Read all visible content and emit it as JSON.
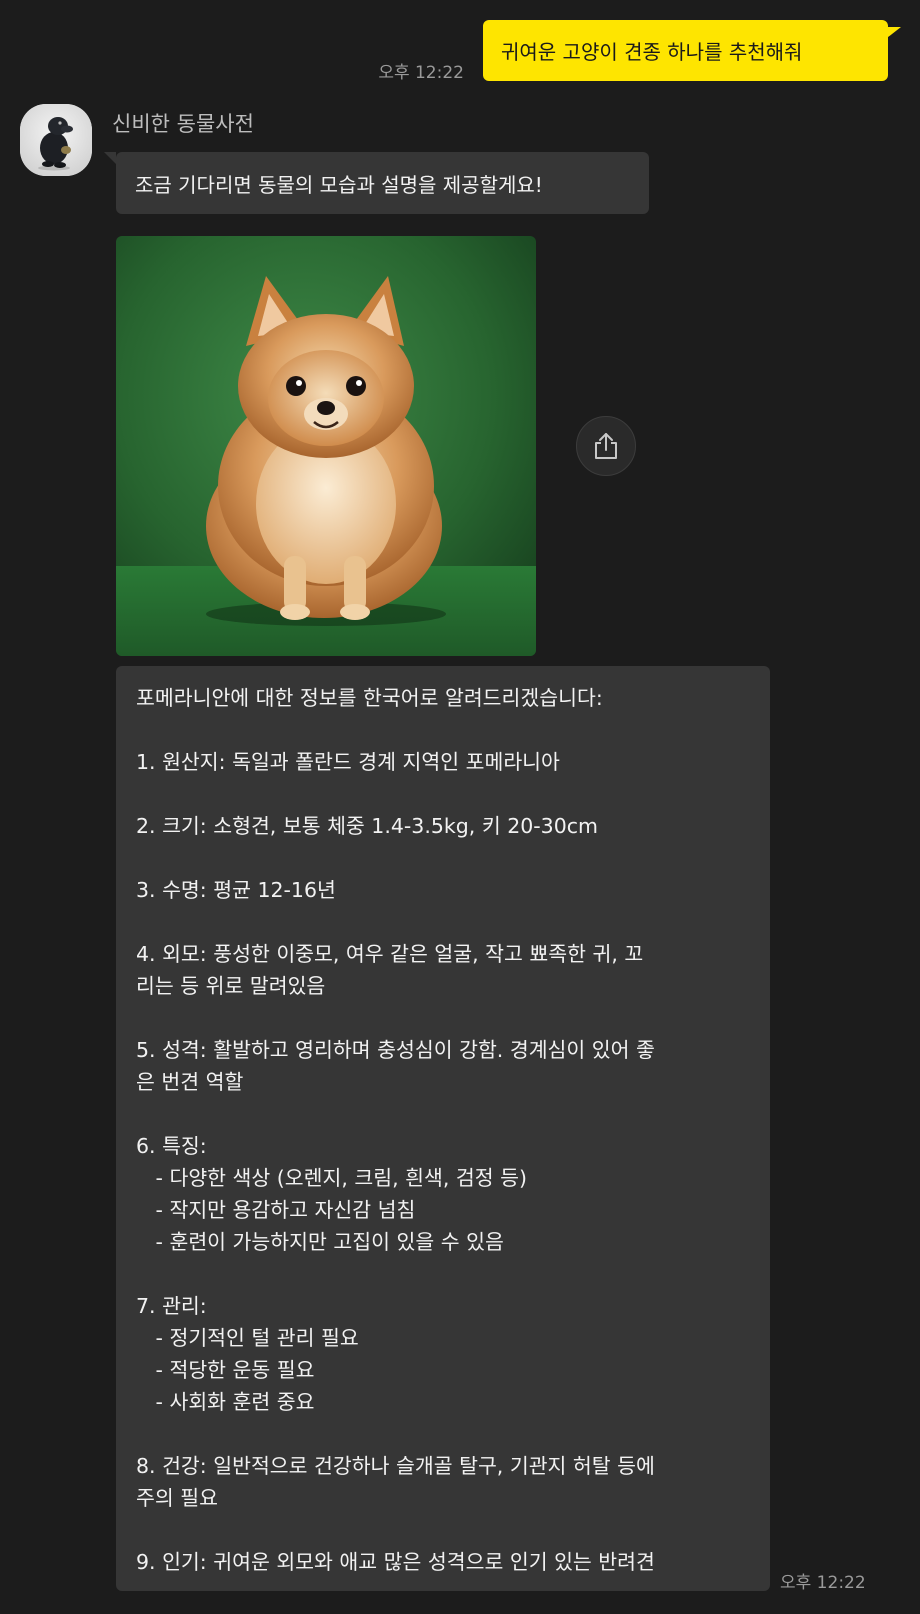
{
  "outgoing": {
    "text": "귀여운 고양이 견종 하나를 추천해줘",
    "time": "오후 12:22",
    "bubble_color": "#fee500"
  },
  "sender": {
    "name": "신비한 동물사전",
    "avatar_icon": "niffler-creature-avatar"
  },
  "incoming": {
    "greeting": "조금 기다리면 동물의 모습과 설명을 제공할게요!",
    "image_icon": "pomeranian-photo",
    "share_icon": "share-icon",
    "time": "오후 12:22",
    "bubble_color": "#363636",
    "info": {
      "intro": "포메라니안에 대한 정보를 한국어로 알려드리겠습니다:",
      "item1": "1. 원산지: 독일과 폴란드 경계 지역인 포메라니아",
      "item2": "2. 크기: 소형견, 보통 체중 1.4-3.5kg, 키 20-30cm",
      "item3": "3. 수명: 평균 12-16년",
      "item4_l1": "4. 외모: 풍성한 이중모, 여우 같은 얼굴, 작고 뾰족한 귀, 꼬",
      "item4_l2": "리는 등 위로 말려있음",
      "item5_l1": "5. 성격: 활발하고 영리하며 충성심이 강함. 경계심이 있어 좋",
      "item5_l2": "은 번견 역할",
      "item6_title": "6. 특징:",
      "item6_sub1": "   - 다양한 색상 (오렌지, 크림, 흰색, 검정 등)",
      "item6_sub2": "   - 작지만 용감하고 자신감 넘침",
      "item6_sub3": "   - 훈련이 가능하지만 고집이 있을 수 있음",
      "item7_title": "7. 관리:",
      "item7_sub1": "   - 정기적인 털 관리 필요",
      "item7_sub2": "   - 적당한 운동 필요",
      "item7_sub3": "   - 사회화 훈련 중요",
      "item8_l1": "8. 건강: 일반적으로 건강하나 슬개골 탈구, 기관지 허탈 등에",
      "item8_l2": "주의 필요",
      "item9": "9. 인기: 귀여운 외모와 애교 많은 성격으로 인기 있는 반려견"
    }
  }
}
